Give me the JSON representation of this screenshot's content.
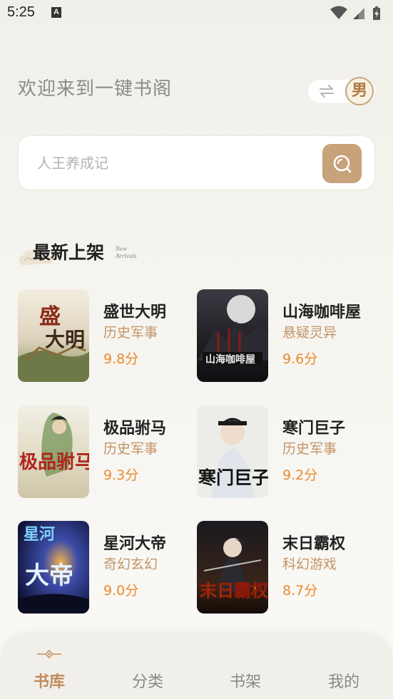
{
  "status_bar": {
    "time": "5:25",
    "notification_badge": "A"
  },
  "header": {
    "welcome_text": "欢迎来到一键书阁",
    "gender_label": "男",
    "swap_icon": "swap-arrows-icon"
  },
  "search": {
    "placeholder": "人王养成记",
    "value": "",
    "icon": "search-icon"
  },
  "section": {
    "title": "最新上架",
    "subtitle_line1": "New",
    "subtitle_line2": "Arrivals"
  },
  "books": [
    {
      "title": "盛世大明",
      "genre": "历史军事",
      "score": "9.8分",
      "cover_text": "盛世大明"
    },
    {
      "title": "山海咖啡屋",
      "genre": "悬疑灵异",
      "score": "9.6分",
      "cover_text": "山海咖啡屋"
    },
    {
      "title": "极品驸马",
      "genre": "历史军事",
      "score": "9.3分",
      "cover_text": "极品驸马"
    },
    {
      "title": "寒门巨子",
      "genre": "历史军事",
      "score": "9.2分",
      "cover_text": "寒门巨子"
    },
    {
      "title": "星河大帝",
      "genre": "奇幻玄幻",
      "score": "9.0分",
      "cover_text": "星河大帝"
    },
    {
      "title": "末日霸权",
      "genre": "科幻游戏",
      "score": "8.7分",
      "cover_text": "末日霸权"
    }
  ],
  "nav": [
    {
      "label": "书库",
      "active": true
    },
    {
      "label": "分类",
      "active": false
    },
    {
      "label": "书架",
      "active": false
    },
    {
      "label": "我的",
      "active": false
    }
  ],
  "colors": {
    "accent": "#c7a27a",
    "genre": "#c49466",
    "score": "#ea8a2c",
    "nav_active": "#c08b5c"
  }
}
